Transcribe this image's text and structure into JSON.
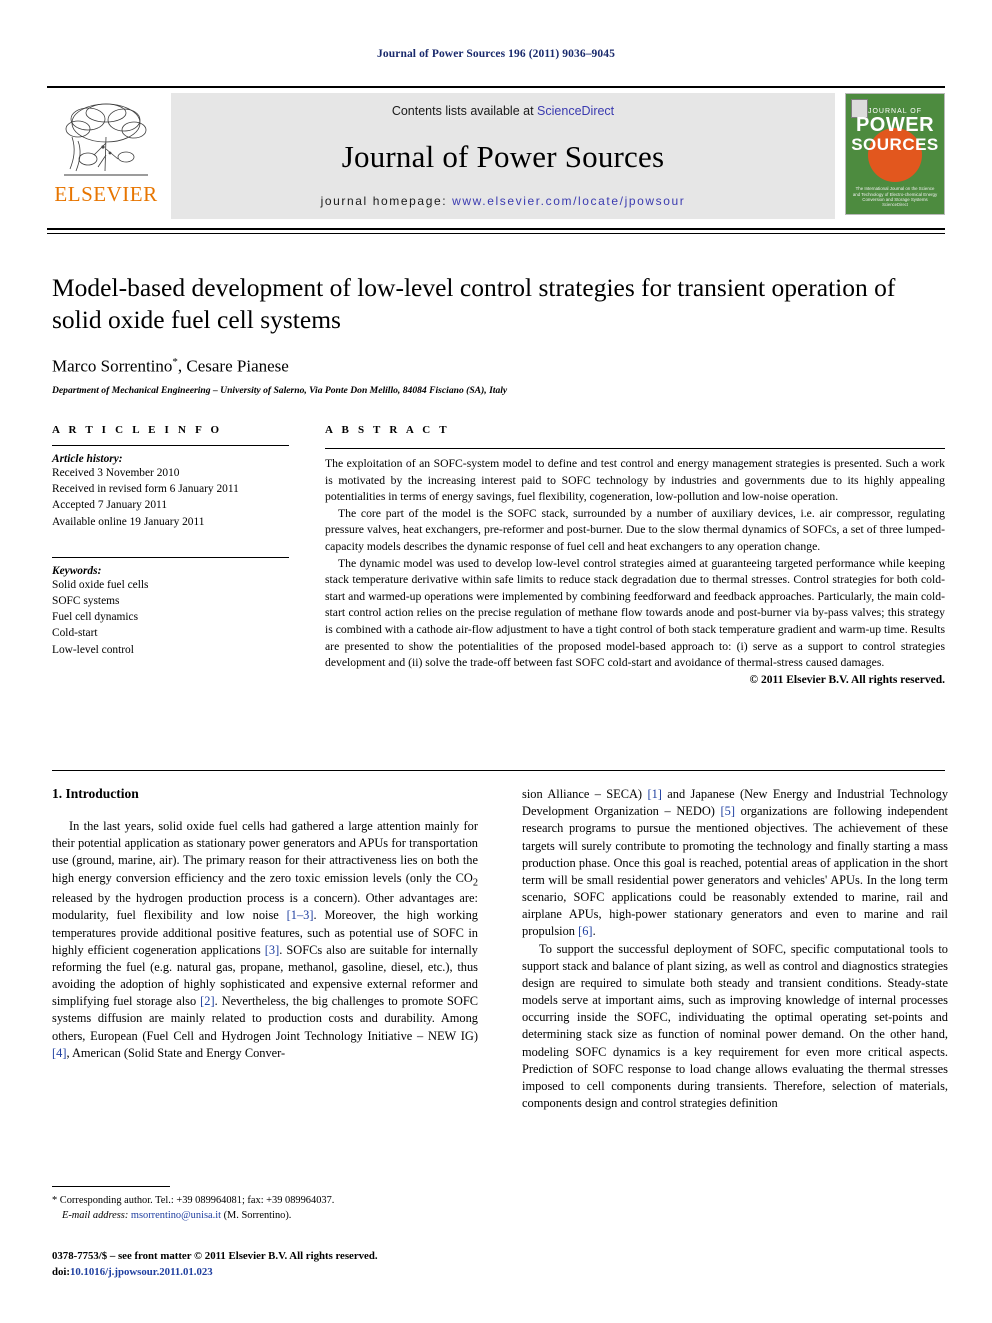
{
  "running_head": "Journal of Power Sources 196 (2011) 9036–9045",
  "masthead": {
    "publisher_wordmark": "ELSEVIER",
    "contents_prefix": "Contents lists available at",
    "sciencedirect": "ScienceDirect",
    "journal_title": "Journal of Power Sources",
    "homepage_prefix": "journal homepage:",
    "homepage_url": "www.elsevier.com/locate/jpowsour",
    "cover": {
      "line_journal_of": "JOURNAL OF",
      "line_power": "POWER",
      "line_sources": "SOURCES",
      "subtitle": "The International Journal on the Science and Technology of Electro-chemical Energy Conversion and Storage Systems",
      "footer": "ScienceDirect",
      "bg_color": "#4d8b3f",
      "accent_color": "#e2571e"
    },
    "accent_orange": "#E77500",
    "link_blue": "#3b3bb0"
  },
  "article": {
    "title": "Model-based development of low-level control strategies for transient operation of solid oxide fuel cell systems",
    "authors": "Marco Sorrentino",
    "authors_suffix": ", Cesare Pianese",
    "corresponding_marker": "*",
    "affiliation": "Department of Mechanical Engineering – University of Salerno, Via Ponte Don Melillo, 84084 Fisciano (SA), Italy"
  },
  "article_info": {
    "heading": "A R T I C L E   I N F O",
    "history_label": "Article history:",
    "history": [
      "Received 3 November 2010",
      "Received in revised form 6 January 2011",
      "Accepted 7 January 2011",
      "Available online 19 January 2011"
    ],
    "keywords_label": "Keywords:",
    "keywords": [
      "Solid oxide fuel cells",
      "SOFC systems",
      "Fuel cell dynamics",
      "Cold-start",
      "Low-level control"
    ]
  },
  "abstract": {
    "heading": "A B S T R A C T",
    "paragraphs": [
      "The exploitation of an SOFC-system model to define and test control and energy management strategies is presented. Such a work is motivated by the increasing interest paid to SOFC technology by industries and governments due to its highly appealing potentialities in terms of energy savings, fuel flexibility, cogeneration, low-pollution and low-noise operation.",
      "The core part of the model is the SOFC stack, surrounded by a number of auxiliary devices, i.e. air compressor, regulating pressure valves, heat exchangers, pre-reformer and post-burner. Due to the slow thermal dynamics of SOFCs, a set of three lumped-capacity models describes the dynamic response of fuel cell and heat exchangers to any operation change.",
      "The dynamic model was used to develop low-level control strategies aimed at guaranteeing targeted performance while keeping stack temperature derivative within safe limits to reduce stack degradation due to thermal stresses. Control strategies for both cold-start and warmed-up operations were implemented by combining feedforward and feedback approaches. Particularly, the main cold-start control action relies on the precise regulation of methane flow towards anode and post-burner via by-pass valves; this strategy is combined with a cathode air-flow adjustment to have a tight control of both stack temperature gradient and warm-up time. Results are presented to show the potentialities of the proposed model-based approach to: (i) serve as a support to control strategies development and (ii) solve the trade-off between fast SOFC cold-start and avoidance of thermal-stress caused damages."
    ],
    "copyright": "© 2011 Elsevier B.V. All rights reserved."
  },
  "body": {
    "section_number_title": "1. Introduction",
    "left_column": {
      "para1_a": "In the last years, solid oxide fuel cells had gathered a large attention mainly for their potential application as stationary power generators and APUs for transportation use (ground, marine, air). The primary reason for their attractiveness lies on both the high energy conversion efficiency and the zero toxic emission levels (only the CO",
      "para1_sub": "2",
      "para1_b": " released by the hydrogen production process is a concern). Other advantages are: modularity, fuel flexibility and low noise ",
      "cite_1_3": "[1–3]",
      "para1_c": ". Moreover, the high working temperatures provide additional positive features, such as potential use of SOFC in highly efficient cogeneration applications ",
      "cite_3": "[3]",
      "para1_d": ". SOFCs also are suitable for internally reforming the fuel (e.g. natural gas, propane, methanol, gasoline, diesel, etc.), thus avoiding the adoption of highly sophisticated and expensive external reformer and simplifying fuel storage also ",
      "cite_2": "[2]",
      "para1_e": ". Nevertheless, the big challenges to promote SOFC systems diffusion are mainly related to production costs and durability. Among others, European (Fuel Cell and Hydrogen Joint Technology Initiative – NEW IG) ",
      "cite_4": "[4]",
      "para1_f": ", American (Solid State and Energy Conver-"
    },
    "right_column": {
      "para1_a": "sion Alliance – SECA) ",
      "cite_1": "[1]",
      "para1_b": " and Japanese (New Energy and Industrial Technology Development Organization – NEDO) ",
      "cite_5": "[5]",
      "para1_c": " organizations are following independent research programs to pursue the mentioned objectives. The achievement of these targets will surely contribute to promoting the technology and finally starting a mass production phase. Once this goal is reached, potential areas of application in the short term will be small residential power generators and vehicles' APUs. In the long term scenario, SOFC applications could be reasonably extended to marine, rail and airplane APUs, high-power stationary generators and even to marine and rail propulsion ",
      "cite_6": "[6]",
      "para1_d": ".",
      "para2": "To support the successful deployment of SOFC, specific computational tools to support stack and balance of plant sizing, as well as control and diagnostics strategies design are required to simulate both steady and transient conditions. Steady-state models serve at important aims, such as improving knowledge of internal processes occurring inside the SOFC, individuating the optimal operating set-points and determining stack size as function of nominal power demand. On the other hand, modeling SOFC dynamics is a key requirement for even more critical aspects. Prediction of SOFC response to load change allows evaluating the thermal stresses imposed to cell components during transients. Therefore, selection of materials, components design and control strategies definition"
    }
  },
  "footnotes": {
    "corresponding_marker": "*",
    "corresponding_text": " Corresponding author. Tel.: +39 089964081; fax: +39 089964037.",
    "email_label": "E-mail address:",
    "email": "msorrentino@unisa.it",
    "email_suffix": " (M. Sorrentino)."
  },
  "imprint": {
    "issn_line": "0378-7753/$ – see front matter © 2011 Elsevier B.V. All rights reserved.",
    "doi_label": "doi:",
    "doi": "10.1016/j.jpowsour.2011.01.023"
  }
}
